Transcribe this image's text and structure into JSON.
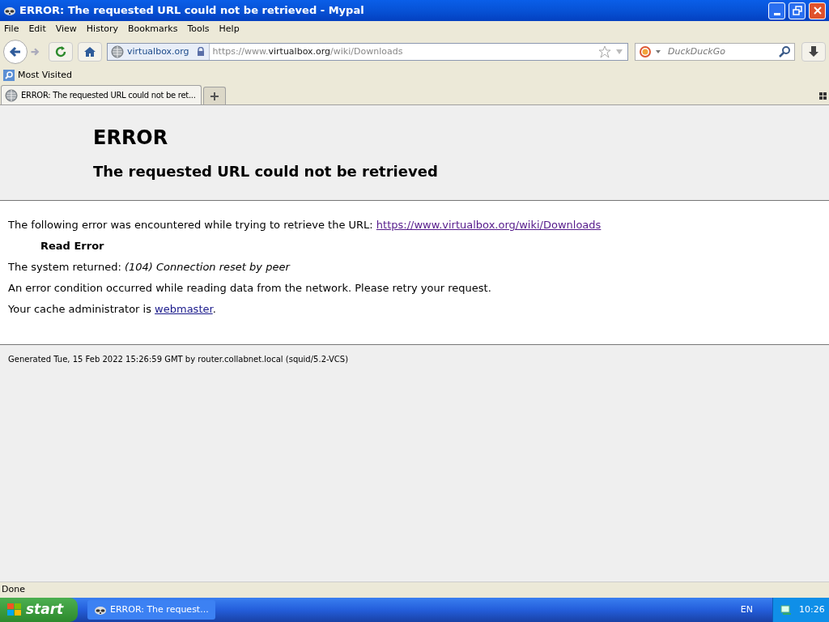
{
  "window": {
    "title": "ERROR: The requested URL could not be retrieved - Mypal"
  },
  "menu": [
    "File",
    "Edit",
    "View",
    "History",
    "Bookmarks",
    "Tools",
    "Help"
  ],
  "navigation": {
    "site_identity": "virtualbox.org",
    "url_parts": [
      {
        "text": "https://www.",
        "kind": "dim"
      },
      {
        "text": "virtualbox.org",
        "kind": "host"
      },
      {
        "text": "/wiki/Downloads",
        "kind": "dim"
      }
    ],
    "search_placeholder": "DuckDuckGo",
    "back_disabled": false,
    "forward_disabled": true
  },
  "bookmarks": [
    "Most Visited"
  ],
  "tabs": [
    {
      "label": "ERROR: The requested URL could not be ret...",
      "selected": true
    }
  ],
  "page": {
    "heading": "ERROR",
    "subheading": "The requested URL could not be retrieved",
    "intro": "The following error was encountered while trying to retrieve the URL: ",
    "intro_link": "https://www.virtualbox.org/wiki/Downloads",
    "error_name": "Read Error",
    "system_returned": "The system returned: *(104) Connection reset by peer*",
    "description": "An error condition occurred while reading data from the network. Please retry your request.",
    "admin_prefix": "Your cache administrator is ",
    "admin_link": "webmaster",
    "admin_suffix": ".",
    "footer": "Generated Tue, 15 Feb 2022 15:26:59 GMT by router.collabnet.local (squid/5.2-VCS)"
  },
  "status_bar": "Done",
  "taskbar": {
    "start": "start",
    "windows": [
      {
        "label": "ERROR: The request...",
        "selected": false
      }
    ],
    "language": "EN",
    "clock": "10:26"
  }
}
